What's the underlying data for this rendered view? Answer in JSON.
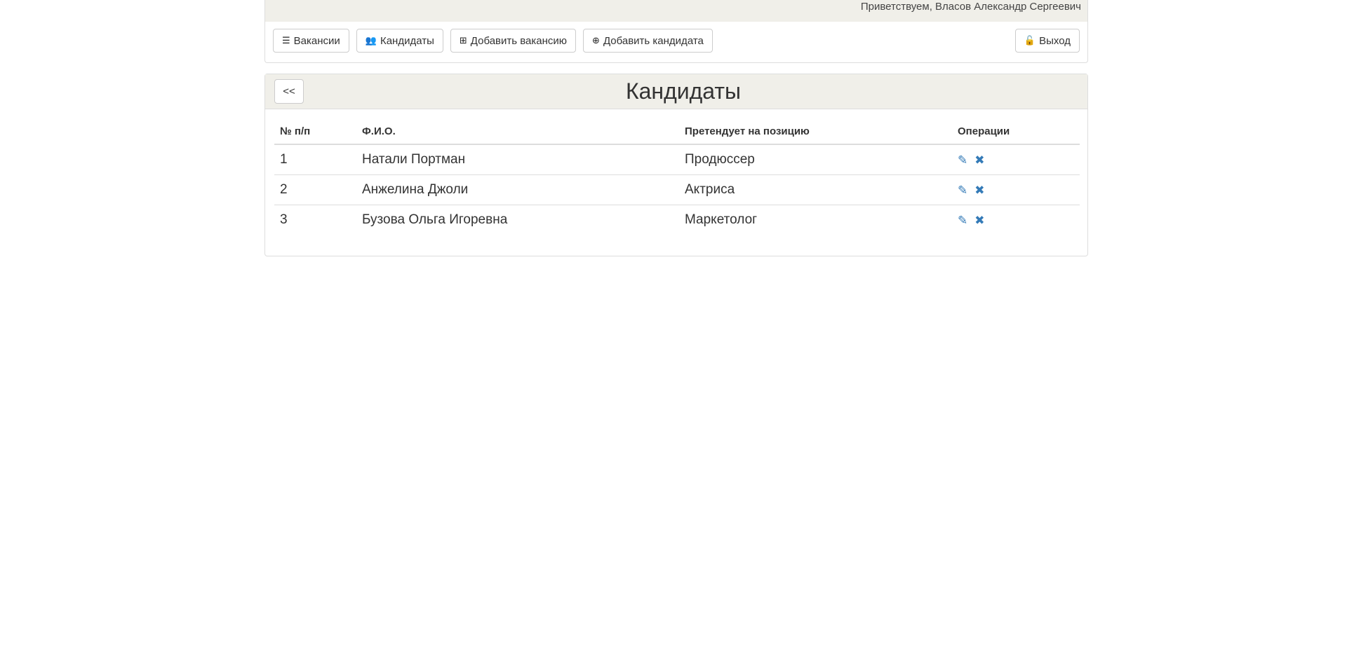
{
  "header": {
    "greeting": "Приветствуем, Власов Александр Сергеевич"
  },
  "nav": {
    "vacancies": "Вакансии",
    "candidates": "Кандидаты",
    "add_vacancy": "Добавить вакансию",
    "add_candidate": "Добавить кандидата",
    "logout": "Выход",
    "icons": {
      "vacancies": "list-icon",
      "candidates": "users-icon",
      "add_vacancy": "plus-square-icon",
      "add_candidate": "plus-circle-icon",
      "logout": "unlock-icon"
    }
  },
  "panel": {
    "back_label": "<<",
    "title": "Кандидаты"
  },
  "table": {
    "headers": {
      "num": "№ п/п",
      "name": "Ф.И.О.",
      "position": "Претендует на позицию",
      "ops": "Операции"
    },
    "rows": [
      {
        "num": "1",
        "name": "Натали Портман",
        "position": "Продюссер"
      },
      {
        "num": "2",
        "name": "Анжелина Джоли",
        "position": "Актриса"
      },
      {
        "num": "3",
        "name": "Бузова Ольга Игоревна",
        "position": "Маркетолог"
      }
    ]
  },
  "colors": {
    "panel_heading_bg": "#f0efe9",
    "link_blue": "#337ab7",
    "border": "#dddddd"
  }
}
